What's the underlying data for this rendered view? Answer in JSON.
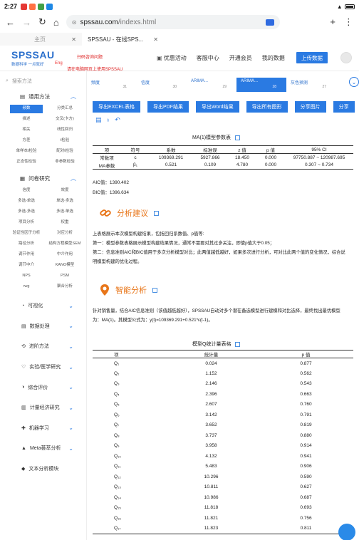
{
  "status": {
    "time": "2:27",
    "battery_label": "battery"
  },
  "browser": {
    "url_site": "spssau.com",
    "url_path": "/indexs.html",
    "tab_count": "1"
  },
  "tabs": [
    {
      "label": "主页"
    },
    {
      "label": "SPSSAU - 在线SPS..."
    }
  ],
  "header": {
    "logo": "SPSSAU",
    "logo_sub": "数据科学 一点就好",
    "eng": "Eng",
    "consult": "扫码咨询问题",
    "pc_notice": "请在电脑网页上使用SPSSAU",
    "nav": [
      "优惠活动",
      "客服中心",
      "开通会员",
      "我的数据"
    ],
    "upload": "上传数据"
  },
  "sidebar": {
    "search_placeholder": "搜索方法",
    "general_title": "通用方法",
    "general_items": [
      "频数",
      "分类汇总",
      "描述",
      "交叉(卡方)",
      "相关",
      "线性回归",
      "方差",
      "t检验",
      "单样本t检验",
      "配对t检验",
      "正态性检验",
      "非参数检验"
    ],
    "survey_title": "问卷研究",
    "survey_items": [
      "信度",
      "效度",
      "多选-单选",
      "单选-多选",
      "多选-多选",
      "多选-单选",
      "项目分析",
      "权重",
      "验证性因子分析",
      "对应分析",
      "路径分析",
      "结构方程模型SEM",
      "调节作用",
      "中介作用",
      "调节中介",
      "KANO模型",
      "NPS",
      "PSM",
      "rwg",
      "聚合分析"
    ],
    "sections": [
      "可视化",
      "数据处理",
      "进阶方法",
      "实验/医学研究",
      "综合评价",
      "计量经济研究",
      "机器学习",
      "Meta荟萃分析",
      "文本分析模块"
    ]
  },
  "subtabs": [
    {
      "label": "频度",
      "num": "31"
    },
    {
      "label": "信度",
      "num": "30"
    },
    {
      "label": "ARIMA...",
      "num": "29"
    },
    {
      "label": "ARIMA...",
      "num": "28"
    },
    {
      "label": "灰色预测",
      "num": "27"
    }
  ],
  "exports": [
    "导出EXCEL表格",
    "导出PDF结果",
    "导出Word结果",
    "导出所有图形",
    "分享图片",
    "分享"
  ],
  "ma_table": {
    "title": "MA(1)模型参数表",
    "headers": [
      "项",
      "符号",
      "系数",
      "标准误",
      "z 值",
      "p 值",
      "95% CI"
    ],
    "rows": [
      [
        "常数项",
        "c",
        "109369.291",
        "5927.866",
        "18.450",
        "0.000",
        "97750.887 ~ 120987.695"
      ],
      [
        "MA参数",
        "β₁",
        "0.521",
        "0.109",
        "4.780",
        "0.000",
        "0.307 ~ 0.734"
      ]
    ],
    "aic": "AIC值：1390.402",
    "bic": "BIC值：1396.634"
  },
  "analysis": {
    "title": "分析建议",
    "para1": "上表格展示本次模型构建结果，包括回归系数值、p值等:",
    "para2": "第一：模型参数表格展示模型构建结果情况，通常不需要对其过多关注，即使p值大于0.05；",
    "para3": "第二：信息准则AIC和BIC值用于多次分析模型对比；此两值越低越好，如果多次进行分析，可对比此两个值的变化情况，综合说明模型构建的优化过程。"
  },
  "smart": {
    "title": "智能分析",
    "para": "针对销售量，结合AIC信息准则（该值越低越好），SPSSAU自动对多个潜在备选模型进行建模和对比选择，最终找出最优模型为：MA(1)。其模型公式为：y(t)=109369.291+0.521*ε(t-1)。"
  },
  "q_table": {
    "title": "模型Q统计量表格",
    "headers": [
      "项",
      "统计量",
      "p 值"
    ],
    "rows": [
      [
        "Q₁",
        "0.024",
        "0.877"
      ],
      [
        "Q₂",
        "1.152",
        "0.562"
      ],
      [
        "Q₃",
        "2.146",
        "0.543"
      ],
      [
        "Q₄",
        "2.396",
        "0.663"
      ],
      [
        "Q₅",
        "2.607",
        "0.760"
      ],
      [
        "Q₆",
        "3.142",
        "0.791"
      ],
      [
        "Q₇",
        "3.652",
        "0.819"
      ],
      [
        "Q₈",
        "3.737",
        "0.880"
      ],
      [
        "Q₉",
        "3.958",
        "0.914"
      ],
      [
        "Q₁₀",
        "4.132",
        "0.941"
      ],
      [
        "Q₁₁",
        "5.483",
        "0.906"
      ],
      [
        "Q₁₂",
        "10.296",
        "0.590"
      ],
      [
        "Q₁₃",
        "10.811",
        "0.627"
      ],
      [
        "Q₁₄",
        "10.986",
        "0.687"
      ],
      [
        "Q₁₅",
        "11.818",
        "0.693"
      ],
      [
        "Q₁₆",
        "11.821",
        "0.756"
      ],
      [
        "Q₁₇",
        "11.823",
        "0.811"
      ]
    ]
  }
}
